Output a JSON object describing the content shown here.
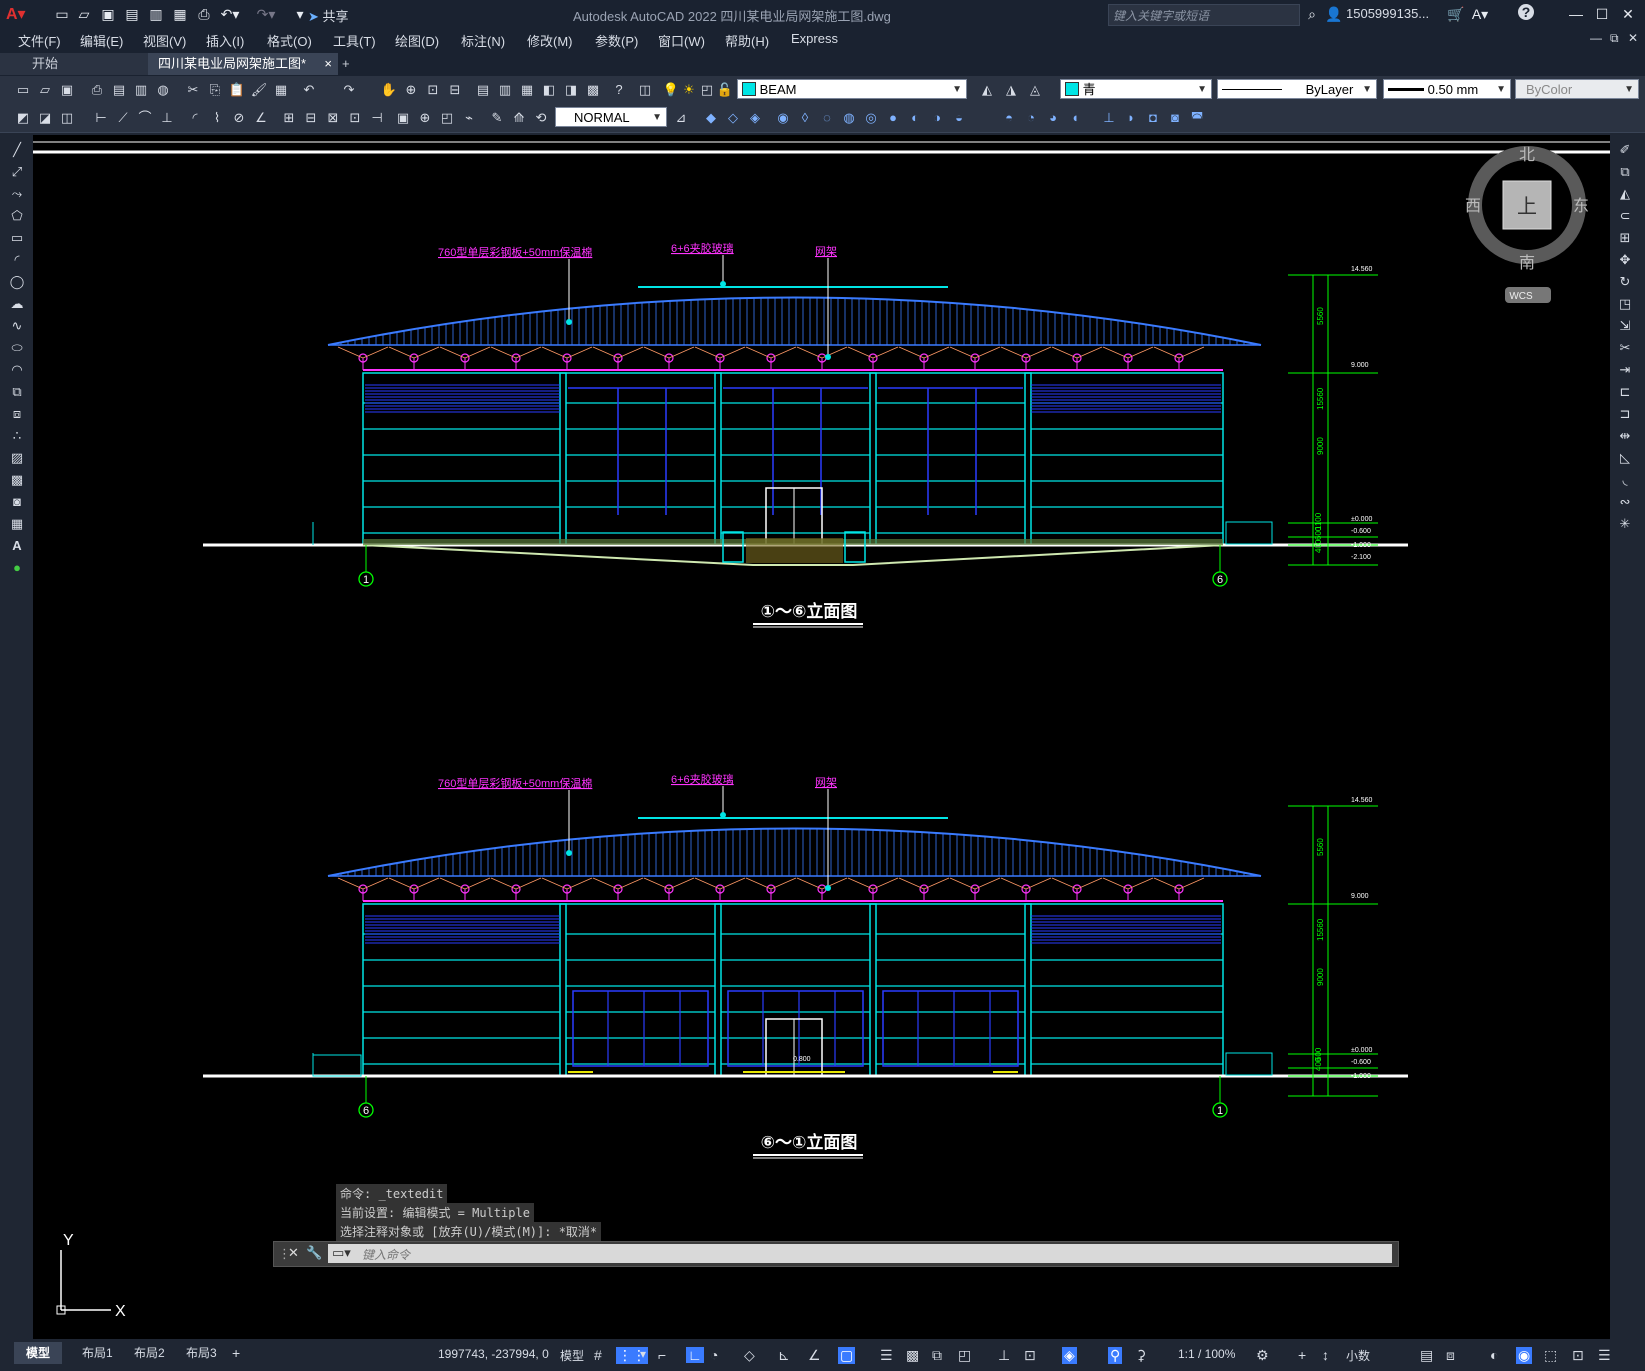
{
  "app": {
    "title": "Autodesk AutoCAD 2022    四川某电业局网架施工图.dwg",
    "share_label": "共享",
    "search_placeholder": "键入关键字或短语",
    "user": "1505999135...",
    "help_label": "?"
  },
  "menu": [
    "文件(F)",
    "编辑(E)",
    "视图(V)",
    "插入(I)",
    "格式(O)",
    "工具(T)",
    "绘图(D)",
    "标注(N)",
    "修改(M)",
    "参数(P)",
    "窗口(W)",
    "帮助(H)",
    "Express"
  ],
  "tabs": {
    "start": "开始",
    "doc": "四川某电业局网架施工图*",
    "close": "×",
    "add": "+"
  },
  "toolbar": {
    "layer": "BEAM",
    "color": "青",
    "linetype": "ByLayer",
    "lineweight": "0.50 mm",
    "plotstyle": "ByColor",
    "textstyle": "NORMAL"
  },
  "viewcube": {
    "north": "北",
    "south": "南",
    "east": "东",
    "west": "西",
    "top": "上",
    "wcs": "WCS"
  },
  "colors": {
    "cyan": "#00e5e5",
    "magenta": "#ff33ff",
    "blue": "#3a7bff",
    "green": "#00ff00",
    "yellow": "#e6e600",
    "white": "#ffffff"
  },
  "drawing": {
    "top_elev": {
      "title": "①～⑥立面图",
      "label_roof": "760型单层彩钢板+50mm保温棉",
      "label_glass": "6+6夹胶玻璃",
      "label_truss": "网架",
      "axis_left": "1",
      "axis_right": "6",
      "dims": [
        "14.560",
        "9.000",
        "±0.000",
        "-0.600",
        "-1.000",
        "-2.100"
      ],
      "vdims": [
        "5560",
        "15560",
        "9000",
        "1100",
        "600",
        "400"
      ]
    },
    "bottom_elev": {
      "title": "⑥～①立面图",
      "label_roof": "760型单层彩钢板+50mm保温棉",
      "label_glass": "6+6夹胶玻璃",
      "label_truss": "网架",
      "axis_left": "6",
      "axis_right": "1",
      "dims": [
        "14.560",
        "9.000",
        "±0.000",
        "-0.600",
        "-1.000"
      ],
      "vdims": [
        "5560",
        "15560",
        "9000",
        "600",
        "400"
      ],
      "door_dim": "0.800"
    }
  },
  "ucs": {
    "x": "X",
    "y": "Y"
  },
  "command": {
    "history": [
      "命令: _textedit",
      "当前设置: 编辑模式 = Multiple",
      "选择注释对象或 [放弃(U)/模式(M)]: *取消*"
    ],
    "placeholder": "键入命令"
  },
  "status": {
    "tabs": [
      "模型",
      "布局1",
      "布局2",
      "布局3"
    ],
    "coords": "1997743, -237994, 0",
    "model": "模型",
    "scale": "1:1 / 100%",
    "units": "小数"
  }
}
